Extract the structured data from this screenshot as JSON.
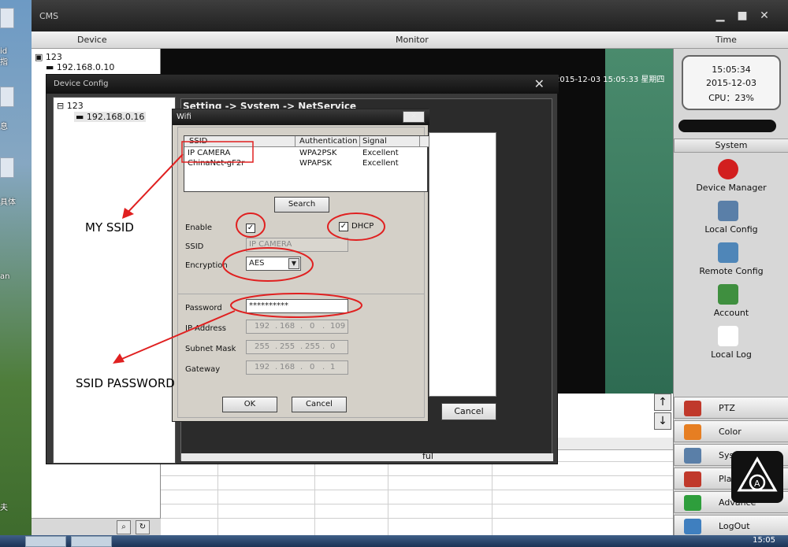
{
  "desktop": {
    "labels": [
      "id",
      "指",
      "息",
      "具体",
      "an",
      "夫"
    ]
  },
  "cms": {
    "title": "CMS",
    "header": {
      "device": "Device",
      "monitor": "Monitor",
      "time": "Time"
    },
    "device_tree": {
      "group": "123",
      "device": "192.168.0.10"
    },
    "monitor_timestamp": "2015-12-03 15:05:33 星期四",
    "time_box": {
      "time": "15:05:34",
      "date": "2015-12-03",
      "cpu": "CPU：23%"
    },
    "system_header": "System",
    "system_menu": [
      {
        "label": "Device Manager",
        "icon": "record-icon",
        "color": "#d21f1f"
      },
      {
        "label": "Local Config",
        "icon": "local-config-icon",
        "color": "#5a7fa8"
      },
      {
        "label": "Remote Config",
        "icon": "remote-config-icon",
        "color": "#4f86b8"
      },
      {
        "label": "Account",
        "icon": "account-icon",
        "color": "#3f8f3f"
      },
      {
        "label": "Local Log",
        "icon": "log-icon",
        "color": "#ffffff"
      }
    ],
    "bottom_menu": [
      {
        "label": "PTZ",
        "icon": "ptz-icon",
        "color": "#c0392b"
      },
      {
        "label": "Color",
        "icon": "color-icon",
        "color": "#e67e22"
      },
      {
        "label": "Syst",
        "icon": "system-icon",
        "color": "#5a7fa8"
      },
      {
        "label": "PlayB",
        "icon": "playback-icon",
        "color": "#c0392b"
      },
      {
        "label": "Advance",
        "icon": "advance-icon",
        "color": "#2e9e3c"
      },
      {
        "label": "LogOut",
        "icon": "logout-icon",
        "color": "#3f7fbf"
      }
    ],
    "log_tail": "ful"
  },
  "device_config": {
    "title": "Device Config",
    "tree_group": "123",
    "tree_device": "192.168.0.16",
    "path": "Setting -> System -> NetService",
    "cancel_label": "Cancel"
  },
  "wifi": {
    "title": "Wifi",
    "close_label": "✕",
    "columns": [
      "SSID",
      "Authentication",
      "Signal"
    ],
    "networks": [
      {
        "ssid": "IP CAMERA",
        "auth": "WPA2PSK",
        "signal": "Excellent"
      },
      {
        "ssid": "ChinaNet-gF2r",
        "auth": "WPAPSK",
        "signal": "Excellent"
      }
    ],
    "search_label": "Search",
    "enable_label": "Enable",
    "dhcp_label": "DHCP",
    "ssid_label": "SSID",
    "ssid_value": "IP CAMERA",
    "encryption_label": "Encryption",
    "encryption_value": "AES",
    "password_label": "Password",
    "password_value": "**********",
    "ip_label": "IP Address",
    "ip_value": [
      "192",
      "168",
      "0",
      "109"
    ],
    "mask_label": "Subnet Mask",
    "mask_value": [
      "255",
      "255",
      "255",
      "0"
    ],
    "gateway_label": "Gateway",
    "gateway_value": [
      "192",
      "168",
      "0",
      "1"
    ],
    "ok_label": "OK",
    "cancel_label": "Cancel"
  },
  "annotations": {
    "my_ssid": "MY SSID",
    "ssid_password": "SSID PASSWORD",
    "color": "#e02020"
  },
  "taskbar": {
    "clock": "15:05"
  }
}
